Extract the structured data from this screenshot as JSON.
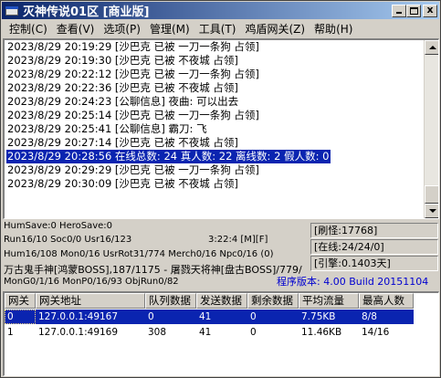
{
  "window": {
    "title": "灭神传说01区 [商业版]",
    "minimize_glyph": "",
    "close_glyph": "x"
  },
  "menu": [
    {
      "label": "控制",
      "acc": "(C)"
    },
    {
      "label": "查看",
      "acc": "(V)"
    },
    {
      "label": "选项",
      "acc": "(P)"
    },
    {
      "label": "管理",
      "acc": "(M)"
    },
    {
      "label": "工具",
      "acc": "(T)"
    },
    {
      "label": "鸡盾网关",
      "acc": "(Z)"
    },
    {
      "label": "帮助",
      "acc": "(H)"
    }
  ],
  "log": [
    "2023/8/29 20:19:29 [沙巴克 已被 一刀一条狗 占领]",
    "2023/8/29 20:19:30 [沙巴克 已被 不夜城 占领]",
    "2023/8/29 20:22:12 [沙巴克 已被 一刀一条狗 占领]",
    "2023/8/29 20:22:36 [沙巴克 已被 不夜城 占领]",
    "2023/8/29 20:24:23 [公聊信息] 夜曲: 可以出去",
    "2023/8/29 20:25:14 [沙巴克 已被 一刀一条狗 占领]",
    "2023/8/29 20:25:41 [公聊信息] 霸刀: 飞",
    "2023/8/29 20:27:14 [沙巴克 已被 不夜城 占领]",
    "2023/8/29 20:28:56 在线总数: 24 真人数: 22 离线数: 2 假人数: 0",
    "2023/8/29 20:29:29 [沙巴克 已被 一刀一条狗 占领]",
    "2023/8/29 20:30:09 [沙巴克 已被 不夜城 占领]"
  ],
  "log_selected_index": 8,
  "status": {
    "line1": "HumSave:0 HeroSave:0",
    "line2": "Run16/10 Soc0/0 Usr16/123",
    "line2b": "3:22:4 [M][F]",
    "line3": "Hum16/108 Mon0/16 UsrRot31/774 Merch0/16 Npc0/16 (0)",
    "line4": "万古鬼手神[鸿蒙BOSS],187/1175 - 屠戮天将神[盘古BOSS]/779/",
    "line5": "MonG0/1/16 MonP0/16/93 ObjRun0/82",
    "version": "程序版本: 4.00 Build 20151104",
    "side": [
      "[刷怪:17768]",
      "[在线:24/24/0]",
      "[引擎:0.1403天]"
    ]
  },
  "table": {
    "headers": [
      "网关",
      "网关地址",
      "队列数据",
      "发送数据",
      "剩余数据",
      "平均流量",
      "最高人数"
    ],
    "rows": [
      [
        "0",
        "127.0.0.1:49167",
        "0",
        "41",
        "0",
        "7.75KB",
        "8/8"
      ],
      [
        "1",
        "127.0.0.1:49169",
        "308",
        "41",
        "0",
        "11.46KB",
        "14/16"
      ]
    ],
    "selected_row": 0
  },
  "colors": {
    "title_start": "#0a246a",
    "title_end": "#a6caf0",
    "selection": "#0a24b0",
    "version_text": "#0000d0"
  }
}
